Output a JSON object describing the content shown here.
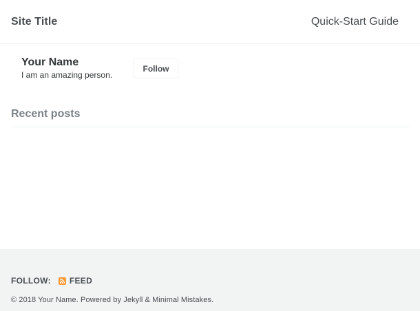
{
  "masthead": {
    "site_title": "Site Title",
    "nav_link": "Quick-Start Guide"
  },
  "author": {
    "name": "Your Name",
    "bio": "I am an amazing person.",
    "follow_label": "Follow"
  },
  "main": {
    "recent_posts_title": "Recent posts"
  },
  "footer": {
    "follow_label": "FOLLOW:",
    "feed_label": "FEED",
    "feed_icon": "rss-icon",
    "copyright": "© 2018 Your Name. Powered by Jekyll & Minimal Mistakes.",
    "accent_color": "#fa9b39",
    "background_color": "#f2f3f3"
  }
}
